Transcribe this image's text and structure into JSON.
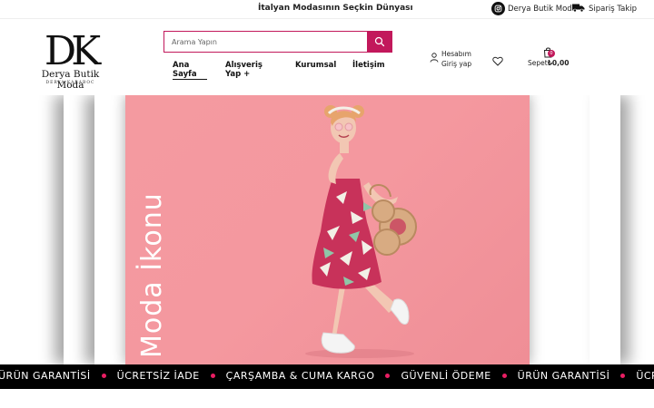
{
  "topbar": {
    "promo": "İtalyan Modasının Seçkin Dünyası",
    "instagram_label": "Derya Butik Moda",
    "track_label": "Sipariş Takip"
  },
  "logo": {
    "monogram": "DK",
    "brand": "Derya Butik Moda",
    "sub": "DERYA KARABOC"
  },
  "search": {
    "placeholder": "Arama Yapın"
  },
  "nav": {
    "items": [
      {
        "label": "Ana Sayfa"
      },
      {
        "label": "Alışveriş Yap +"
      },
      {
        "label": "Kurumsal"
      },
      {
        "label": "İletişim"
      }
    ]
  },
  "account": {
    "line1": "Hesabım",
    "line2": "Giriş yap"
  },
  "cart": {
    "badge": "0",
    "label": "Sepet",
    "total": "₺0,00"
  },
  "hero": {
    "vertical_text": "Moda İkonu"
  },
  "marquee": {
    "items": [
      "ÜRÜN GARANTİSİ",
      "ÜCRETSİZ İADE",
      "ÇARŞAMBA & CUMA KARGO",
      "GÜVENLİ ÖDEME",
      "ÜRÜN GARANTİSİ",
      "ÜCRETSİZ İADE"
    ]
  },
  "colors": {
    "accent": "#c2185b",
    "dot": "#e91e63",
    "hero_bg": "#f4989f"
  }
}
